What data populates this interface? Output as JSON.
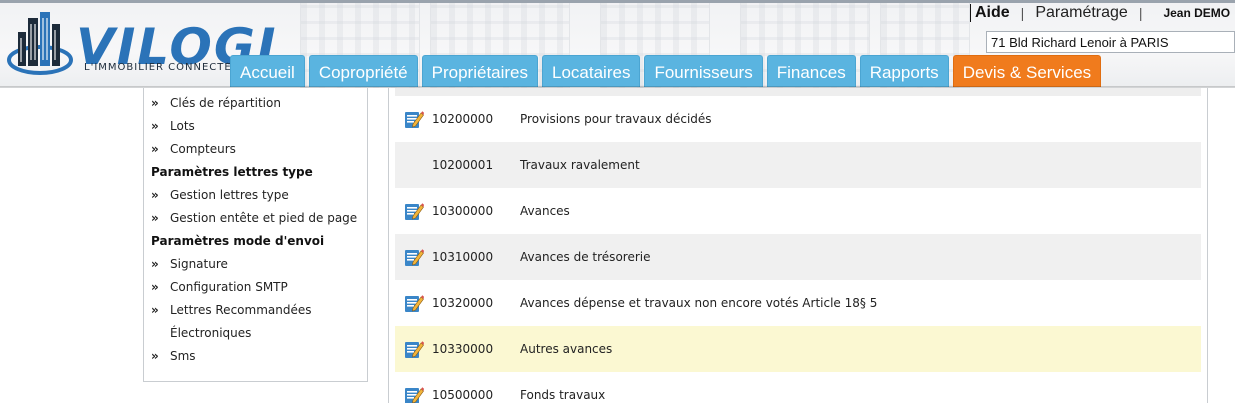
{
  "header": {
    "logo": {
      "wordmark": "VILOGI",
      "tagline": "L'IMMOBILIER CONNECTÉ"
    },
    "links": {
      "help": "Aide",
      "separator": "|",
      "settings": "Paramétrage",
      "user": "Jean DEMO"
    },
    "address": {
      "value": "71 Bld Richard Lenoir à PARIS"
    }
  },
  "nav": {
    "tabs": [
      {
        "label": "Accueil",
        "active": false
      },
      {
        "label": "Copropriété",
        "active": false
      },
      {
        "label": "Propriétaires",
        "active": false
      },
      {
        "label": "Locataires",
        "active": false
      },
      {
        "label": "Fournisseurs",
        "active": false
      },
      {
        "label": "Finances",
        "active": false
      },
      {
        "label": "Rapports",
        "active": false
      },
      {
        "label": "Devis & Services",
        "active": true
      }
    ]
  },
  "sidebar": {
    "chevron": "»",
    "items": [
      {
        "kind": "item",
        "label": "Clés de répartition"
      },
      {
        "kind": "item",
        "label": "Lots"
      },
      {
        "kind": "item",
        "label": "Compteurs"
      },
      {
        "kind": "section",
        "label": "Paramètres lettres type"
      },
      {
        "kind": "item",
        "label": "Gestion lettres type"
      },
      {
        "kind": "item",
        "label": "Gestion entête et pied de page"
      },
      {
        "kind": "section",
        "label": "Paramètres mode d'envoi"
      },
      {
        "kind": "item",
        "label": "Signature"
      },
      {
        "kind": "item",
        "label": "Configuration SMTP"
      },
      {
        "kind": "item",
        "label": "Lettres Recommandées"
      },
      {
        "kind": "cont",
        "label": "Électroniques"
      },
      {
        "kind": "item",
        "label": "Sms"
      }
    ]
  },
  "accounts": {
    "rows": [
      {
        "code": "10200000",
        "label": "Provisions pour travaux décidés",
        "editable": true,
        "state": "normal"
      },
      {
        "code": "10200001",
        "label": "Travaux ravalement",
        "editable": false,
        "state": "shaded"
      },
      {
        "code": "10300000",
        "label": "Avances",
        "editable": true,
        "state": "normal"
      },
      {
        "code": "10310000",
        "label": "Avances de trésorerie",
        "editable": true,
        "state": "shaded"
      },
      {
        "code": "10320000",
        "label": "Avances dépense et travaux non encore votés Article 18§ 5",
        "editable": true,
        "state": "normal"
      },
      {
        "code": "10330000",
        "label": "Autres avances",
        "editable": true,
        "state": "selected"
      },
      {
        "code": "10500000",
        "label": "Fonds travaux",
        "editable": true,
        "state": "normal"
      }
    ]
  },
  "colors": {
    "tab_blue": "#5ab4e0",
    "tab_active_orange": "#f07b1d",
    "logo_blue": "#2b73b8",
    "row_shaded": "#f0f0f0",
    "row_selected": "#fbf8d2",
    "edit_icon_blue": "#3a86c8"
  },
  "icons": {
    "edit": "edit-note-icon",
    "logo": "building-logo-icon"
  }
}
